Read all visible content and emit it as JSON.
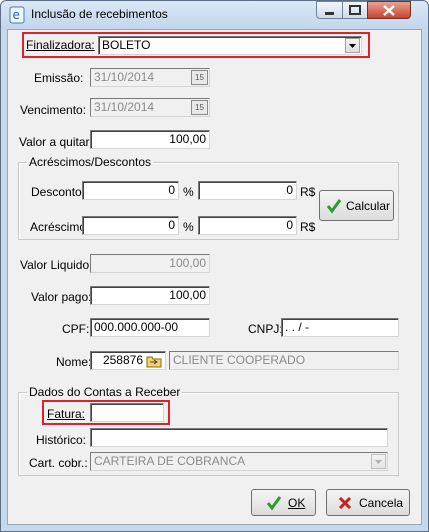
{
  "window": {
    "title": "Inclusão de recebimentos"
  },
  "finalizadora": {
    "label": "Finalizadora:",
    "value": "BOLETO"
  },
  "emissao": {
    "label": "Emissão:",
    "value": "31/10/2014"
  },
  "vencimento": {
    "label": "Vencimento:",
    "value": "31/10/2014"
  },
  "valor_a_quitar": {
    "label": "Valor a quitar:",
    "value": "100,00"
  },
  "acrescimos_descontos": {
    "title": "Acréscimos/Descontos",
    "desconto_label": "Desconto:",
    "desconto_pct": "0",
    "desconto_rs": "0",
    "acrescimo_label": "Acréscimo:",
    "acrescimo_pct": "0",
    "acrescimo_rs": "0",
    "pct_symbol": "%",
    "rs_symbol": "R$",
    "calcular_label": "Calcular"
  },
  "valor_liquido": {
    "label": "Valor Liquido:",
    "value": "100,00"
  },
  "valor_pago": {
    "label": "Valor pago:",
    "value": "100,00"
  },
  "cpf": {
    "label": "CPF:",
    "value": "000.000.000-00"
  },
  "cnpj": {
    "label": "CNPJ:",
    "value": " .   .   /   -"
  },
  "nome": {
    "label": "Nome:",
    "code": "258876",
    "value": "CLIENTE COOPERADO"
  },
  "contas_receber": {
    "title": "Dados do Contas a Receber",
    "fatura_label": "Fatura:",
    "fatura_value": "",
    "historico_label": "Histórico:",
    "historico_value": "",
    "cart_cobr_label": "Cart. cobr.:",
    "cart_cobr_value": "CARTEIRA DE COBRANCA"
  },
  "actions": {
    "ok_label": "OK",
    "cancel_label": "Cancela"
  },
  "calendar_icon_text": "15",
  "colors": {
    "highlight": "#e0202a",
    "ok_check": "#2e9b2e",
    "cancel_x": "#c8201c"
  }
}
